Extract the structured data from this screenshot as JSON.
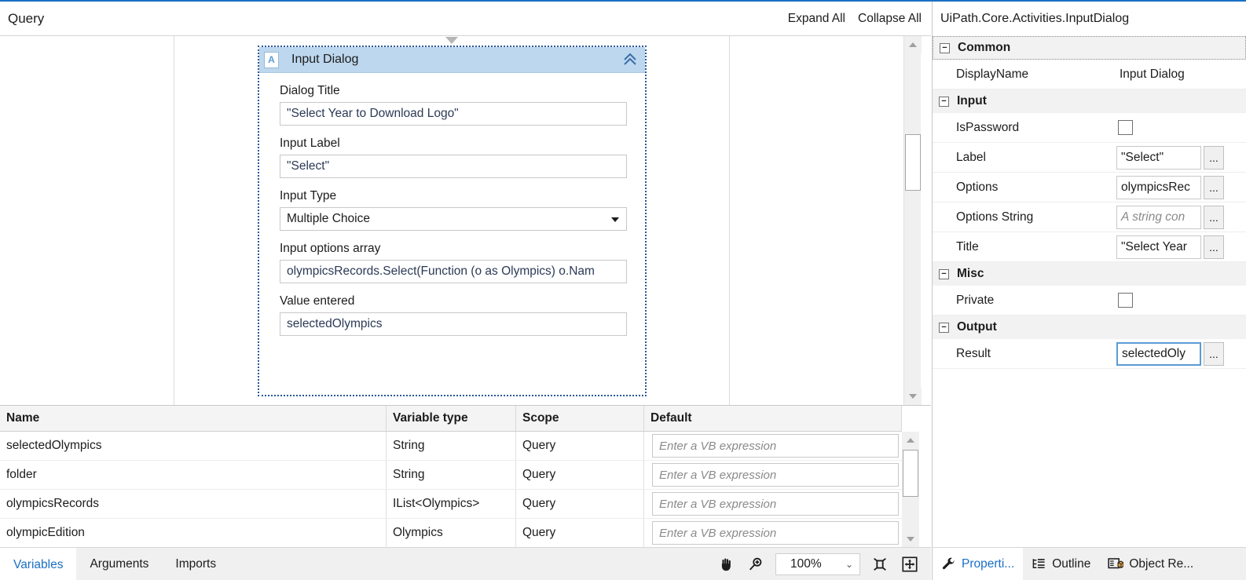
{
  "designer": {
    "breadcrumb": "Query",
    "expand_all_label": "Expand All",
    "collapse_all_label": "Collapse All"
  },
  "activity": {
    "icon_glyph": "A",
    "title": "Input Dialog",
    "collapse_icon": "chevrons-up-icon",
    "fields": [
      {
        "label": "Dialog Title",
        "value": "\"Select Year to Download Logo\"",
        "type": "text"
      },
      {
        "label": "Input Label",
        "value": "\"Select\"",
        "type": "text"
      },
      {
        "label": "Input Type",
        "value": "Multiple Choice",
        "type": "combo"
      },
      {
        "label": "Input options array",
        "value": "olympicsRecords.Select(Function (o as Olympics) o.Nam",
        "type": "text"
      },
      {
        "label": "Value entered",
        "value": "selectedOlympics",
        "type": "text"
      }
    ]
  },
  "variables": {
    "columns": [
      "Name",
      "Variable type",
      "Scope",
      "Default"
    ],
    "default_placeholder": "Enter a VB expression",
    "rows": [
      {
        "name": "selectedOlympics",
        "type": "String",
        "scope": "Query",
        "default": ""
      },
      {
        "name": "folder",
        "type": "String",
        "scope": "Query",
        "default": ""
      },
      {
        "name": "olympicsRecords",
        "type": "IList<Olympics>",
        "scope": "Query",
        "default": ""
      },
      {
        "name": "olympicEdition",
        "type": "Olympics",
        "scope": "Query",
        "default": ""
      }
    ]
  },
  "bottom_tabs": [
    {
      "label": "Variables",
      "active": true
    },
    {
      "label": "Arguments",
      "active": false
    },
    {
      "label": "Imports",
      "active": false
    }
  ],
  "zoom_controls": {
    "pan_icon": "hand-icon",
    "zoom_icon": "magnifier-icon",
    "zoom_level": "100%",
    "dropdown_icon": "chevron-down-icon",
    "fit_to_content_icon": "fit-content-icon",
    "fit_to_screen_icon": "fit-screen-icon"
  },
  "properties": {
    "type_title": "UiPath.Core.Activities.InputDialog",
    "groups": [
      {
        "name": "Common",
        "selected": true,
        "rows": [
          {
            "name": "DisplayName",
            "value": "Input Dialog",
            "kind": "text"
          }
        ]
      },
      {
        "name": "Input",
        "selected": false,
        "rows": [
          {
            "name": "IsPassword",
            "value": "",
            "kind": "checkbox",
            "checked": false
          },
          {
            "name": "Label",
            "value": "\"Select\"",
            "kind": "expression",
            "browse": "..."
          },
          {
            "name": "Options",
            "value": "olympicsRec",
            "kind": "expression",
            "browse": "..."
          },
          {
            "name": "Options String",
            "value": "A string con",
            "kind": "expression-placeholder",
            "browse": "..."
          },
          {
            "name": "Title",
            "value": "\"Select Year",
            "kind": "expression",
            "browse": "..."
          }
        ]
      },
      {
        "name": "Misc",
        "selected": false,
        "rows": [
          {
            "name": "Private",
            "value": "",
            "kind": "checkbox",
            "checked": false
          }
        ]
      },
      {
        "name": "Output",
        "selected": false,
        "rows": [
          {
            "name": "Result",
            "value": "selectedOly",
            "kind": "expression-focused",
            "browse": "..."
          }
        ]
      }
    ]
  },
  "properties_tabs": [
    {
      "label": "Properti...",
      "icon": "wrench-icon",
      "active": true
    },
    {
      "label": "Outline",
      "icon": "outline-icon",
      "active": false
    },
    {
      "label": "Object Re...",
      "icon": "object-icon",
      "active": false
    }
  ],
  "colors": {
    "accent": "#1a6fc4",
    "activity_header": "#bdd7ee",
    "selection_border": "#2b579a",
    "group_bg": "#f2f2f2"
  }
}
